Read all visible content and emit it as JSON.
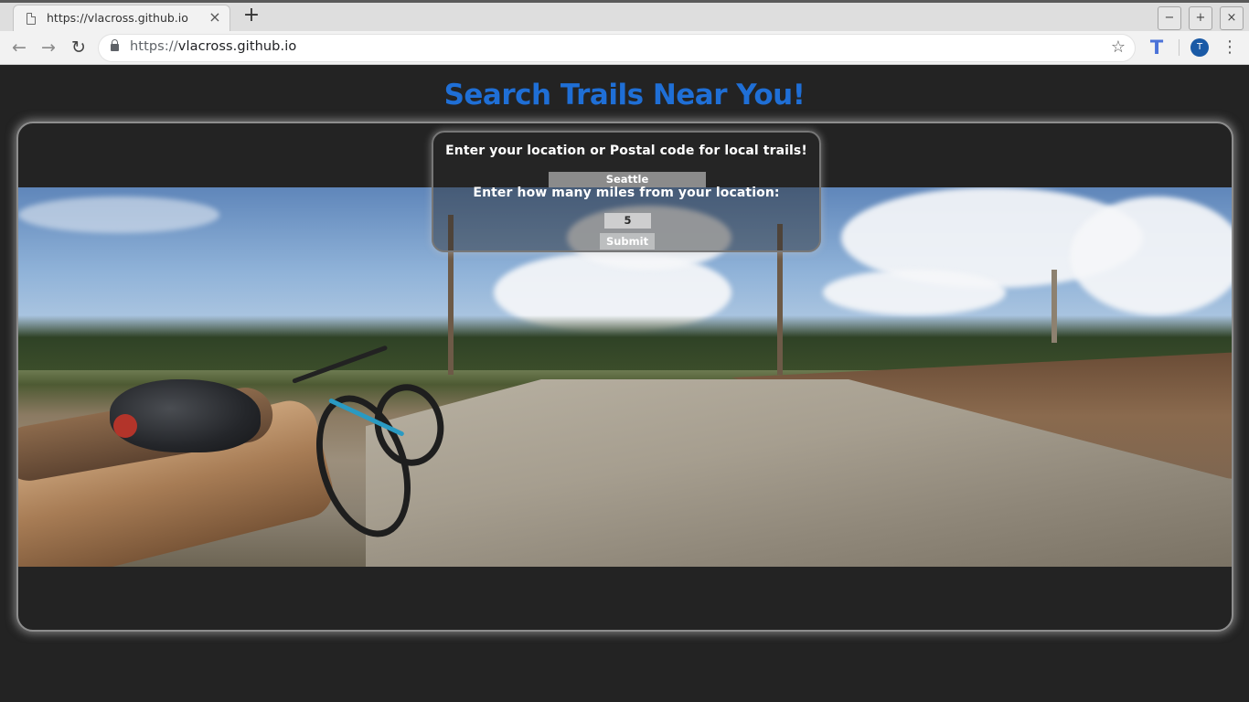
{
  "browser": {
    "tab_title": "https://vlacross.github.io",
    "tab_close": "×",
    "new_tab": "+",
    "url_scheme": "https://",
    "url_host": "vlacross.github.io",
    "avatar_initial": "T",
    "window_controls": {
      "minimize": "−",
      "maximize": "+",
      "close": "×"
    },
    "nav": {
      "back": "←",
      "forward": "→",
      "reload": "↻"
    },
    "star": "☆",
    "menu": "⋮",
    "extension": "T"
  },
  "page": {
    "headline": "Search Trails Near You!",
    "form": {
      "location_label": "Enter your location or Postal code for local trails!",
      "location_value": "Seattle",
      "miles_label": "Enter how many miles from your location:",
      "miles_value": "5",
      "submit_label": "Submit"
    }
  },
  "colors": {
    "headline": "#1f6fd6",
    "background": "#232323",
    "panel_border": "#8d8d8d"
  }
}
